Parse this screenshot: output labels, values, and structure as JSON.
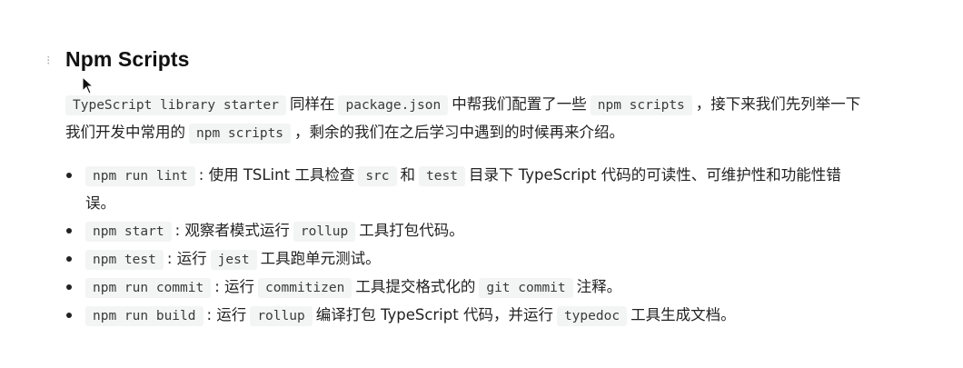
{
  "heading": "Npm Scripts",
  "intro": {
    "code1": "TypeScript library starter",
    "text1": "同样在",
    "code2": "package.json",
    "text2": "中帮我们配置了一些",
    "code3": "npm scripts",
    "text3": "，接下来我们先列举一下我们开发中常用的",
    "code4": "npm scripts",
    "text4": "，剩余的我们在之后学习中遇到的时候再来介绍。"
  },
  "items": [
    {
      "cmd": "npm run lint",
      "t1": ": 使用 TSLint 工具检查",
      "c1": "src",
      "t2": "和",
      "c2": "test",
      "t3": "目录下 TypeScript 代码的可读性、可维护性和功能性错误。"
    },
    {
      "cmd": "npm start",
      "t1": ": 观察者模式运行",
      "c1": "rollup",
      "t2": "工具打包代码。"
    },
    {
      "cmd": "npm test",
      "t1": ": 运行",
      "c1": "jest",
      "t2": "工具跑单元测试。"
    },
    {
      "cmd": "npm run commit",
      "t1": ": 运行",
      "c1": "commitizen",
      "t2": "工具提交格式化的",
      "c2": "git commit",
      "t3": "注释。"
    },
    {
      "cmd": "npm run build",
      "t1": ": 运行",
      "c1": "rollup",
      "t2": "编译打包 TypeScript 代码，并运行",
      "c2": "typedoc",
      "t3": "工具生成文档。"
    }
  ]
}
